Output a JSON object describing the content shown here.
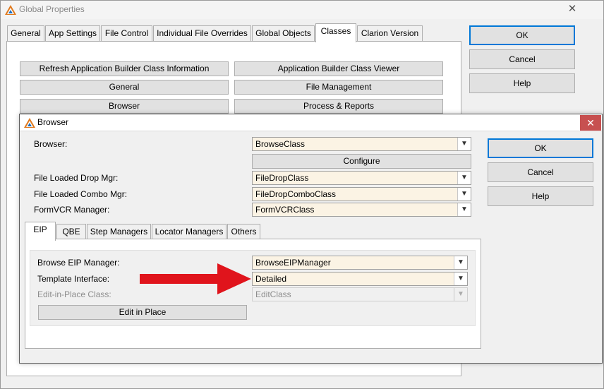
{
  "outer_window": {
    "title": "Global Properties",
    "tabs": [
      {
        "label": "General"
      },
      {
        "label": "App Settings"
      },
      {
        "label": "File Control"
      },
      {
        "label": "Individual File Overrides"
      },
      {
        "label": "Global Objects"
      },
      {
        "label": "Classes"
      },
      {
        "label": "Clarion Version"
      }
    ],
    "buttons": {
      "refresh": "Refresh Application Builder Class Information",
      "viewer": "Application Builder Class Viewer",
      "general": "General",
      "file_management": "File Management",
      "browser": "Browser",
      "process_reports": "Process & Reports",
      "ok": "OK",
      "cancel": "Cancel",
      "help": "Help"
    }
  },
  "browser_dialog": {
    "title": "Browser",
    "fields": {
      "browser_label": "Browser:",
      "browser_value": "BrowseClass",
      "configure_button": "Configure",
      "file_drop_label": "File Loaded Drop Mgr:",
      "file_drop_value": "FileDropClass",
      "file_combo_label": "File Loaded Combo Mgr:",
      "file_combo_value": "FileDropComboClass",
      "formvcr_label": "FormVCR Manager:",
      "formvcr_value": "FormVCRClass"
    },
    "tabs": [
      {
        "label": "EIP"
      },
      {
        "label": "QBE"
      },
      {
        "label": "Step Managers"
      },
      {
        "label": "Locator Managers"
      },
      {
        "label": "Others"
      }
    ],
    "eip": {
      "browse_eip_label": "Browse EIP Manager:",
      "browse_eip_value": "BrowseEIPManager",
      "template_label": "Template Interface:",
      "template_value": "Detailed",
      "eip_class_label": "Edit-in-Place Class:",
      "eip_class_value": "EditClass",
      "edit_in_place_button": "Edit in Place"
    },
    "buttons": {
      "ok": "OK",
      "cancel": "Cancel",
      "help": "Help"
    },
    "annotation_arrow_color": "#e0141c"
  },
  "icons": {
    "app": "clarion-logo-icon",
    "close": "close-icon",
    "dropdown": "chevron-down-icon"
  }
}
